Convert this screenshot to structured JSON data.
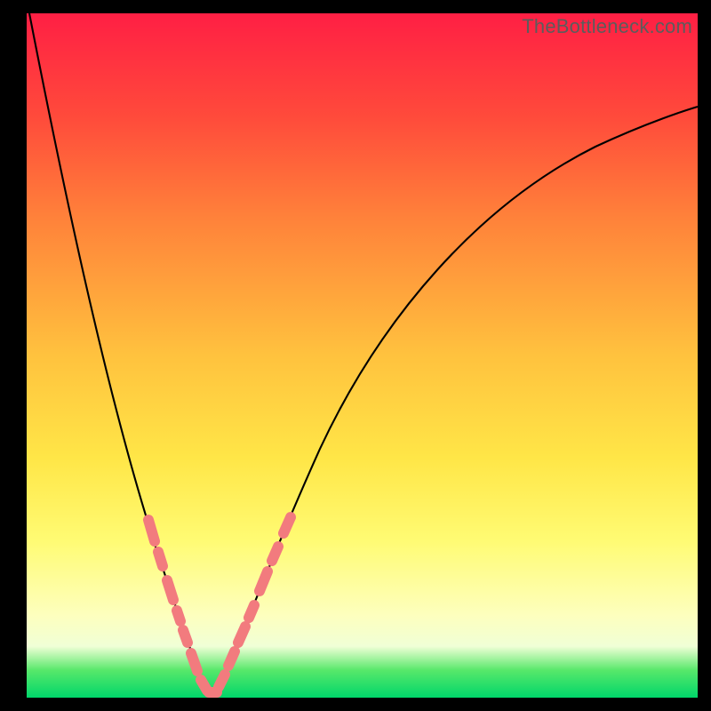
{
  "watermark": "TheBottleneck.com",
  "colors": {
    "bead": "#f27b7e",
    "curve": "#000000"
  },
  "chart_data": {
    "type": "line",
    "title": "",
    "xlabel": "",
    "ylabel": "",
    "xlim": [
      0,
      100
    ],
    "ylim": [
      0,
      100
    ],
    "x": [
      0,
      5,
      10,
      15,
      17,
      19,
      21,
      23,
      25,
      27,
      29,
      32,
      35,
      38,
      42,
      47,
      53,
      60,
      68,
      77,
      87,
      100
    ],
    "values": [
      100,
      78,
      57,
      38,
      31,
      24,
      17,
      10,
      3,
      0,
      3,
      12,
      22,
      32,
      43,
      53,
      62,
      70,
      76,
      81,
      85,
      88
    ],
    "series": [
      {
        "name": "bottleneck-curve",
        "x": [
          0,
          5,
          10,
          15,
          17,
          19,
          21,
          23,
          25,
          27,
          29,
          32,
          35,
          38,
          42,
          47,
          53,
          60,
          68,
          77,
          87,
          100
        ],
        "values": [
          100,
          78,
          57,
          38,
          31,
          24,
          17,
          10,
          3,
          0,
          3,
          12,
          22,
          32,
          43,
          53,
          62,
          70,
          76,
          81,
          85,
          88
        ]
      }
    ],
    "highlighted_segments": [
      {
        "side": "left",
        "x_range": [
          17,
          26
        ],
        "value_range": [
          31,
          1
        ]
      },
      {
        "side": "right",
        "x_range": [
          27,
          36
        ],
        "value_range": [
          1,
          25
        ]
      }
    ]
  }
}
